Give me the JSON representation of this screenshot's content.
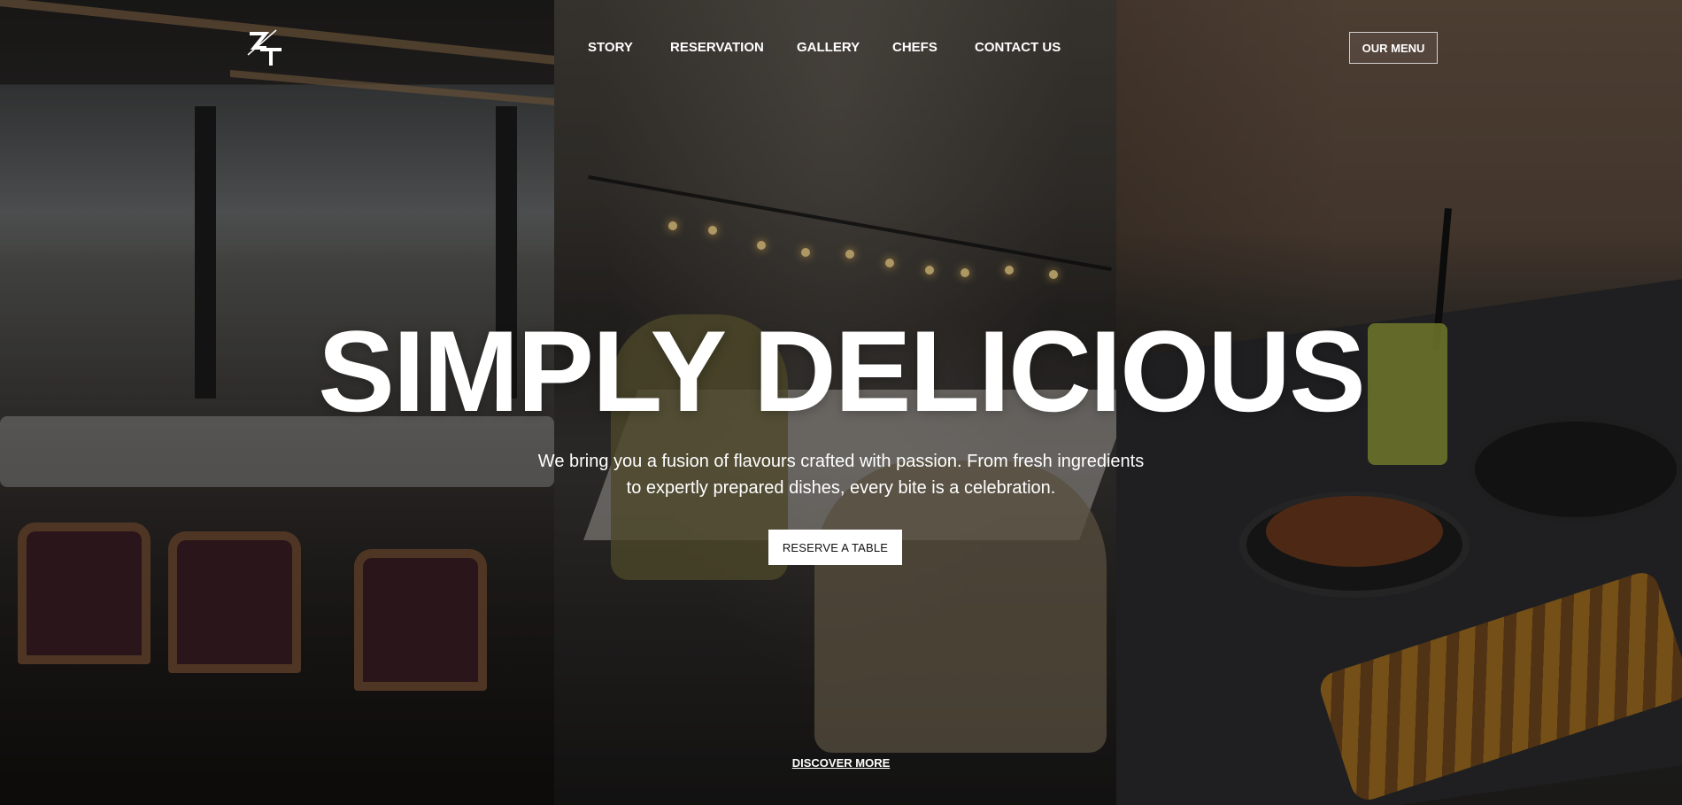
{
  "header": {
    "logo_text": "ZT",
    "nav": [
      {
        "label": "STORY"
      },
      {
        "label": "RESERVATION"
      },
      {
        "label": "GALLERY"
      },
      {
        "label": "CHEFS"
      },
      {
        "label": "CONTACT US"
      }
    ],
    "menu_button": "OUR MENU"
  },
  "hero": {
    "title": "SIMPLY DELICIOUS",
    "subtitle_line1": "We bring you a fusion of flavours crafted with passion. From fresh ingredients",
    "subtitle_line2": "to expertly prepared dishes, every bite is a celebration.",
    "cta": "RESERVE A TABLE",
    "discover": "DISCOVER MORE"
  },
  "colors": {
    "text": "#ffffff",
    "button_bg": "#ffffff",
    "button_text": "#111111"
  },
  "icons": [
    "zt-logo-icon"
  ]
}
